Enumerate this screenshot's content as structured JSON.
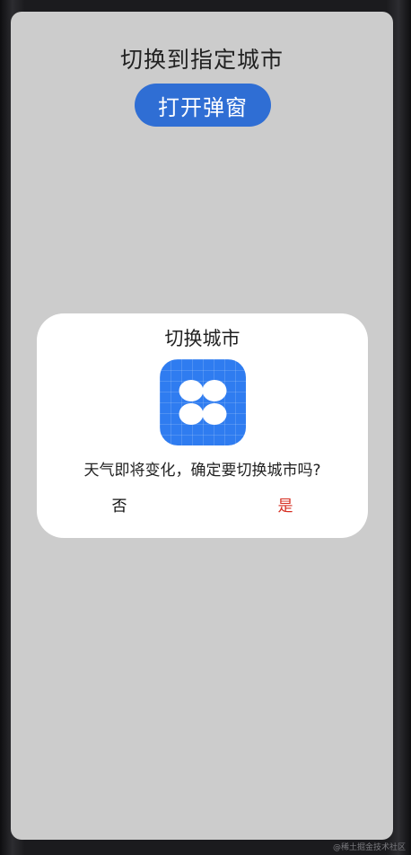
{
  "page": {
    "title": "切换到指定城市",
    "open_button_label": "打开弹窗"
  },
  "dialog": {
    "title": "切换城市",
    "icon": "clover-app-icon",
    "message": "天气即将变化，确定要切换城市吗?",
    "cancel_label": "否",
    "confirm_label": "是"
  },
  "watermark": "@稀土掘金技术社区",
  "colors": {
    "background": "#cccccc",
    "button": "#2f6ed4",
    "icon": "#2f7cf0",
    "confirm": "#d62d20"
  }
}
